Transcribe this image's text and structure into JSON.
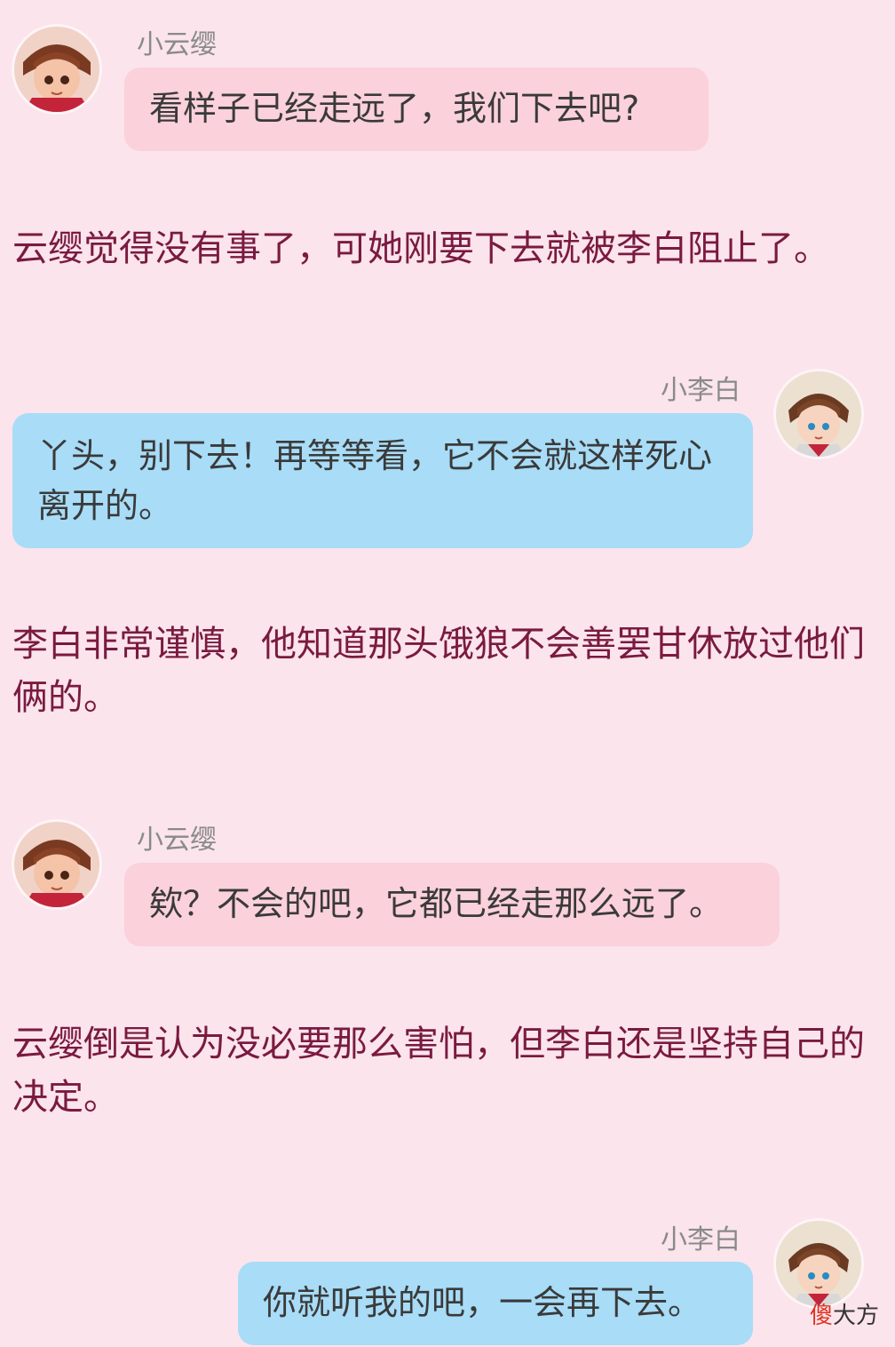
{
  "messages": [
    {
      "speaker": "小云缨",
      "avatar_icon": "girl-avatar-icon",
      "text": "看样子已经走远了，我们下去吧?"
    },
    {
      "narration": "云缨觉得没有事了，可她刚要下去就被李白阻止了。"
    },
    {
      "speaker": "小李白",
      "avatar_icon": "boy-avatar-icon",
      "text": "丫头，别下去！再等等看，它不会就这样死心离开的。"
    },
    {
      "narration": "李白非常谨慎，他知道那头饿狼不会善罢甘休放过他们俩的。"
    },
    {
      "speaker": "小云缨",
      "avatar_icon": "girl-avatar-icon",
      "text": "欸？不会的吧，它都已经走那么远了。"
    },
    {
      "narration": "云缨倒是认为没必要那么害怕，但李白还是坚持自己的决定。"
    },
    {
      "speaker": "小李白",
      "avatar_icon": "boy-avatar-icon",
      "text": "你就听我的吧，一会再下去。"
    }
  ],
  "watermark": {
    "first_char": "傻",
    "rest": "大方"
  },
  "colors": {
    "background": "#fbe4ec",
    "pink_bubble": "#fbd1db",
    "blue_bubble": "#a8dcf7",
    "narration_text": "#7a1a3f"
  }
}
